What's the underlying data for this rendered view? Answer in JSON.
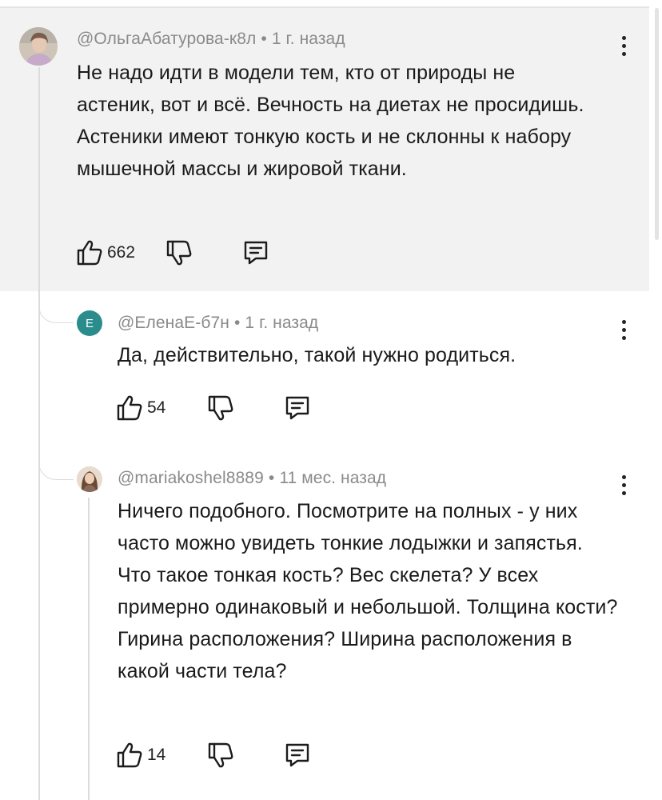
{
  "comments": [
    {
      "author": "@ОльгаАбатурова-к8л",
      "separator": "•",
      "time": "1 г. назад",
      "text": "Не надо идти в модели тем, кто от природы не астеник, вот и всё. Вечность на диетах не просидишь. Астеники имеют тонкую кость и не склонны к набору мышечной массы и жировой ткани.",
      "likes": "662"
    },
    {
      "author": "@ЕленаЕ-б7н",
      "separator": "•",
      "time": "1 г. назад",
      "avatar_letter": "Е",
      "avatar_color": "#2a8c8c",
      "text": "Да, действительно, такой нужно родиться.",
      "likes": "54"
    },
    {
      "author": "@mariakoshel8889",
      "separator": "•",
      "time": "11 мес. назад",
      "text": "Ничего подобного. Посмотрите на полных - у них часто можно увидеть тонкие лодыжки и запястья. Что такое тонкая кость? Вес скелета? У всех примерно одинаковый и небольшой. Толщина кости? Гирина расположения? Ширина расположения в какой части тела?",
      "likes": "14"
    }
  ],
  "icons": {
    "like": "thumbs-up-icon",
    "dislike": "thumbs-down-icon",
    "reply": "reply-comment-icon",
    "more": "more-vertical-icon"
  },
  "colors": {
    "highlight_bg": "#f2f2f2",
    "meta_text": "#8a8a8a",
    "body_text": "#1a1a1a",
    "avatar_letter_bg": "#2a8c8c"
  }
}
